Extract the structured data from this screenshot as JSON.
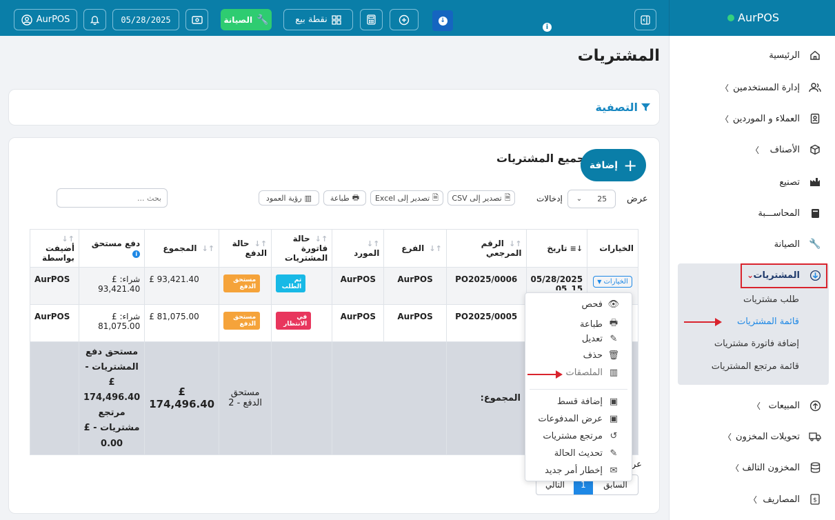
{
  "brand": {
    "name": "AurPOS",
    "status_color": "#35d07f"
  },
  "topbar": {
    "user_label": "AurPOS",
    "date": "05/28/2025",
    "maintenance_label": "الصيانة",
    "pos_label": "نقطة بيع",
    "bg_color": "#0a7ea8"
  },
  "page": {
    "title": "المشتريات"
  },
  "filter": {
    "title": "التصفية"
  },
  "list": {
    "title": "جميع المشتريات",
    "add_label": "إضافة",
    "show_label": "عرض",
    "entries_value": "25",
    "entries_label": "إدخالات",
    "search_placeholder": "بحث ...",
    "export_csv": "تصدير إلى CSV",
    "export_excel": "تصدير إلى Excel",
    "print": "طباعة",
    "column_visibility": "رؤية العمود"
  },
  "table": {
    "headers": {
      "options": "الخيارات",
      "date": "تاريخ",
      "ref": "الرقم المرجعي",
      "branch": "الفرع",
      "supplier": "المورد",
      "invoice_status": "حالة فاتورة المشتريات",
      "payment_status": "حالة الدفع",
      "total": "المجموع",
      "payment_due": "دفع مستحق",
      "added_by": "أضيفت بواسطة"
    },
    "options_button": "الخيارات",
    "rows": [
      {
        "date": "05/28/2025",
        "date2": "05_15",
        "ref": "PO2025/0006",
        "branch": "AurPOS",
        "supplier": "AurPOS",
        "invoice_status": "تم الطلب",
        "invoice_status_color": "#18b9e6",
        "payment_status": "مستحق الدفع",
        "payment_status_color": "#f5a33a",
        "total": "£ 93,421.40",
        "payment_due": "شراء: £ 93,421.40",
        "added_by": "AurPOS"
      },
      {
        "ref": "PO2025/0005",
        "branch": "AurPOS",
        "supplier": "AurPOS",
        "invoice_status": "في الانتظار",
        "invoice_status_color": "#e8365d",
        "payment_status": "مستحق الدفع",
        "payment_status_color": "#f5a33a",
        "total": "£ 81,075.00",
        "payment_due": "شراء: £ 81,075.00",
        "added_by": "AurPOS"
      }
    ],
    "footer": {
      "label": "المجموع:",
      "payment_status": "مستحق الدفع - 2",
      "total": "£ 174,496.40",
      "payment_due": "مستحق دفع المشتريات - £ 174,496.40 مرتجع مشتريات - £ 0.00"
    }
  },
  "pagination": {
    "prev": "السابق",
    "page": "1",
    "next": "التالي",
    "show_prefix": "عر"
  },
  "dropdown": {
    "items": [
      {
        "label": "فحص",
        "icon": "eye-icon",
        "glyph": "👁"
      },
      {
        "label": "طباعة",
        "icon": "print-icon",
        "glyph": "🖶"
      },
      {
        "label": "تعديل",
        "icon": "edit-icon",
        "glyph": "✎"
      },
      {
        "label": "حذف",
        "icon": "trash-icon",
        "glyph": "🗑"
      },
      {
        "label": "الملصقات",
        "icon": "barcode-icon",
        "glyph": "▥"
      },
      {
        "label": "إضافة قسط",
        "icon": "money-icon",
        "glyph": "▣"
      },
      {
        "label": "عرض المدفوعات",
        "icon": "money-icon",
        "glyph": "▣"
      },
      {
        "label": "مرتجع مشتريات",
        "icon": "undo-icon",
        "glyph": "↺"
      },
      {
        "label": "تحديث الحالة",
        "icon": "edit-icon",
        "glyph": "✎"
      },
      {
        "label": "إخطار أمر جديد",
        "icon": "envelope-icon",
        "glyph": "✉"
      }
    ]
  },
  "sidebar": {
    "items": [
      {
        "label": "الرئيسية",
        "icon": "home-icon"
      },
      {
        "label": "إدارة المستخدمين",
        "icon": "users-icon"
      },
      {
        "label": "العملاء و الموردين",
        "icon": "contacts-icon"
      },
      {
        "label": "الأصناف",
        "icon": "cube-icon"
      },
      {
        "label": "تصنيع",
        "icon": "factory-icon"
      },
      {
        "label": "المحاســـبة",
        "icon": "book-icon"
      },
      {
        "label": "الصيانة",
        "icon": "wrench-icon"
      },
      {
        "label": "المشتريات",
        "icon": "download-icon"
      },
      {
        "label": "المبيعات",
        "icon": "upload-icon"
      },
      {
        "label": "تحويلات المخزون",
        "icon": "truck-icon"
      },
      {
        "label": "المخزون التالف",
        "icon": "database-icon"
      },
      {
        "label": "المصاريف",
        "icon": "dollar-icon"
      }
    ],
    "purchase_sub": [
      {
        "label": "طلب مشتريات"
      },
      {
        "label": "قائمة المشتريات",
        "active": true
      },
      {
        "label": "إضافة فاتورة مشتريات"
      },
      {
        "label": "قائمة مرتجع المشتريات"
      }
    ],
    "active_color": "#1e88e5",
    "highlight_color": "#d9232d"
  }
}
